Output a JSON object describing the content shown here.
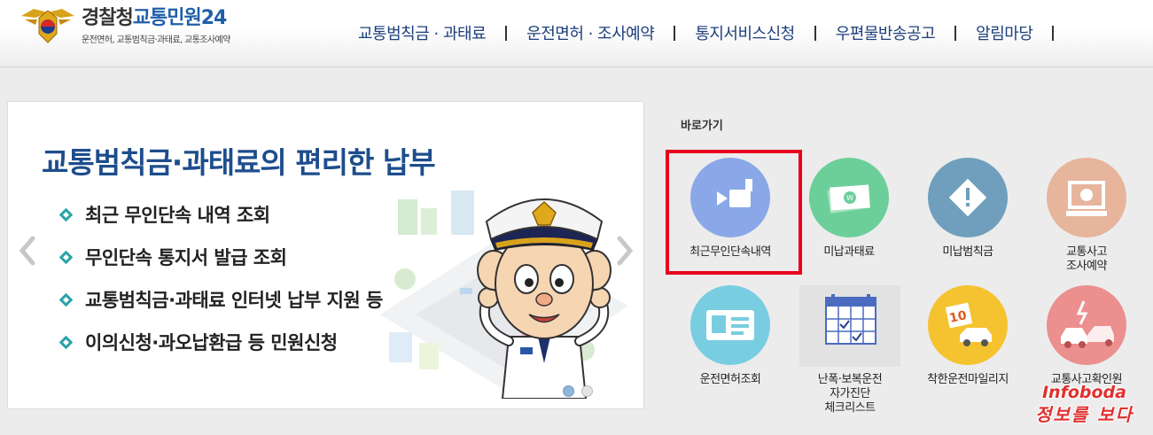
{
  "header": {
    "logo_main_a": "경찰청",
    "logo_main_b": "교통민원24",
    "logo_sub": "운전면허, 교통범칙금·과태료, 교통조사예약",
    "nav": [
      "교통범칙금 · 과태료",
      "운전면허 · 조사예약",
      "통지서비스신청",
      "우편물반송공고",
      "알림마당"
    ]
  },
  "banner": {
    "title": "교통범칙금·과태료의 편리한 납부",
    "bullets": [
      "최근 무인단속 내역 조회",
      "무인단속 통지서 발급 조회",
      "교통범칙금·과태료 인터넷 납부 지원 등",
      "이의신청·과오납환급 등 민원신청"
    ],
    "active_slide": 1,
    "slide_count": 2
  },
  "quick": {
    "title": "바로가기",
    "tiles": [
      {
        "icon": "camera-icon",
        "color": "#8aa8e8",
        "lines": [
          "최근무인단속내역"
        ]
      },
      {
        "icon": "money-icon",
        "color": "#6ccf9a",
        "lines": [
          "미납과태료"
        ]
      },
      {
        "icon": "warning-icon",
        "color": "#6f9fbd",
        "lines": [
          "미납범칙금"
        ]
      },
      {
        "icon": "monitor-icon",
        "color": "#e7b59c",
        "lines": [
          "교통사고",
          "조사예약"
        ]
      },
      {
        "icon": "license-card-icon",
        "color": "#79cde0",
        "lines": [
          "운전면허조회"
        ]
      },
      {
        "icon": "calendar-check-icon",
        "color": "#e2e2e2",
        "lines": [
          "난폭·보복운전",
          "자가진단",
          "체크리스트"
        ]
      },
      {
        "icon": "mileage-car-icon",
        "color": "#f5c330",
        "lines": [
          "착한운전마일리지"
        ]
      },
      {
        "icon": "accident-car-icon",
        "color": "#ec8f8f",
        "lines": [
          "교통사고확인원"
        ]
      }
    ]
  },
  "watermark": {
    "line1": "Infoboda",
    "line2": "정보를 보다"
  }
}
